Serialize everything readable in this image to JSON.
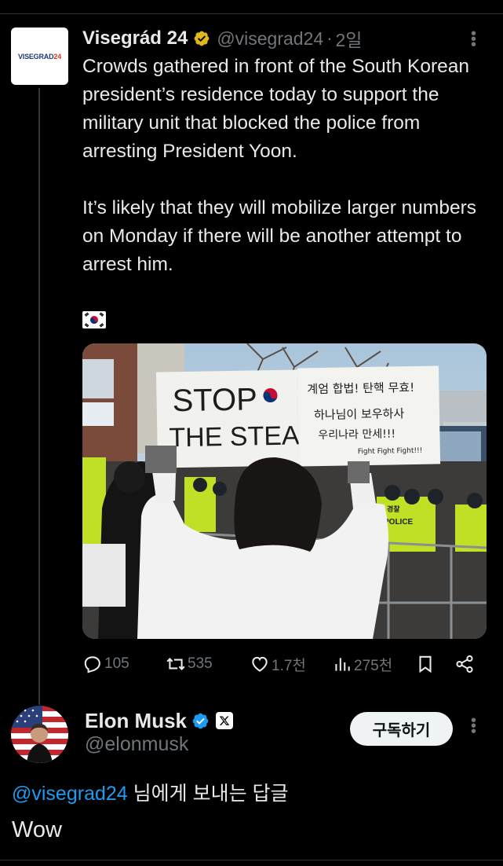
{
  "parent_tweet": {
    "author_name": "Visegrád 24",
    "handle": "@visegrad24",
    "separator": "·",
    "time": "2일",
    "avatar_text_a": "VISEGRAD",
    "avatar_text_b": "24",
    "text_p1": "Crowds gathered in front of the South Korean president’s residence today to support the military unit that blocked the police from arresting President Yoon.",
    "text_p2": "It’s likely that they will mobilize larger numbers on Monday if there will be another attempt to arrest him.",
    "flag_emoji_name": "south-korea-flag",
    "photo": {
      "sign_left_line1": "STOP",
      "sign_left_line2": "THE STEAL",
      "sign_right_line1": "계엄 합법! 탄핵 무효!",
      "sign_right_line2": "하나님이 보우하사",
      "sign_right_line3": "우리나라 만세!!!",
      "sign_right_line4": "Fight Fight Fight!!!",
      "police_vest_text": "POLICE",
      "police_badge_text": "경찰"
    },
    "stats": {
      "replies": "105",
      "reposts": "535",
      "likes": "1.7천",
      "views": "275천"
    }
  },
  "reply_tweet": {
    "author_name": "Elon Musk",
    "handle": "@elonmusk",
    "subscribe_label": "구독하기",
    "reply_to_mention": "@visegrad24",
    "reply_to_suffix": " 님에게 보내는 답글",
    "text": "Wow"
  },
  "colors": {
    "background": "#000000",
    "text": "#e7e9ea",
    "muted": "#71767b",
    "link": "#1d9bf0",
    "verified_gold": "#e2b719",
    "verified_blue": "#1d9bf0"
  }
}
